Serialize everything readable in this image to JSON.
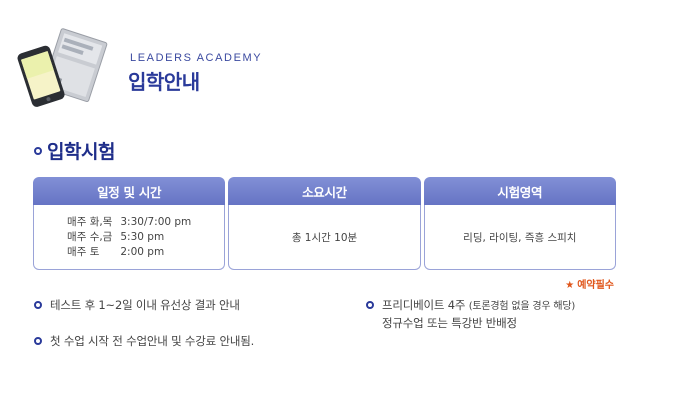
{
  "header": {
    "brand": "LEADERS ACADEMY",
    "title": "입학안내"
  },
  "section": {
    "title": "입학시험"
  },
  "table": {
    "headers": [
      "일정 및 시간",
      "소요시간",
      "시험영역"
    ],
    "schedule": [
      {
        "day": "매주 화,목",
        "time": "3:30/7:00 pm"
      },
      {
        "day": "매주 수,금",
        "time": "5:30 pm"
      },
      {
        "day": "매주 토",
        "time": "2:00 pm"
      }
    ],
    "duration": "총 1시간 10분",
    "areas": "리딩, 라이팅, 즉흥 스피치"
  },
  "reserve_note": "예약필수",
  "notes": {
    "note1": "테스트 후 1~2일 이내 유선상 결과 안내",
    "note2": "첫 수업 시작 전 수업안내 및 수강료 안내됨.",
    "note3_main": "프리디베이트 4주",
    "note3_sub": "(토론경험 없을 경우 해당)",
    "note3_line2": "정규수업 또는 특강반 반배정"
  },
  "colors": {
    "accent": "#2a3a9a",
    "header_bg": "#7482cc",
    "border": "#9aa3d8",
    "highlight": "#e0561b"
  }
}
